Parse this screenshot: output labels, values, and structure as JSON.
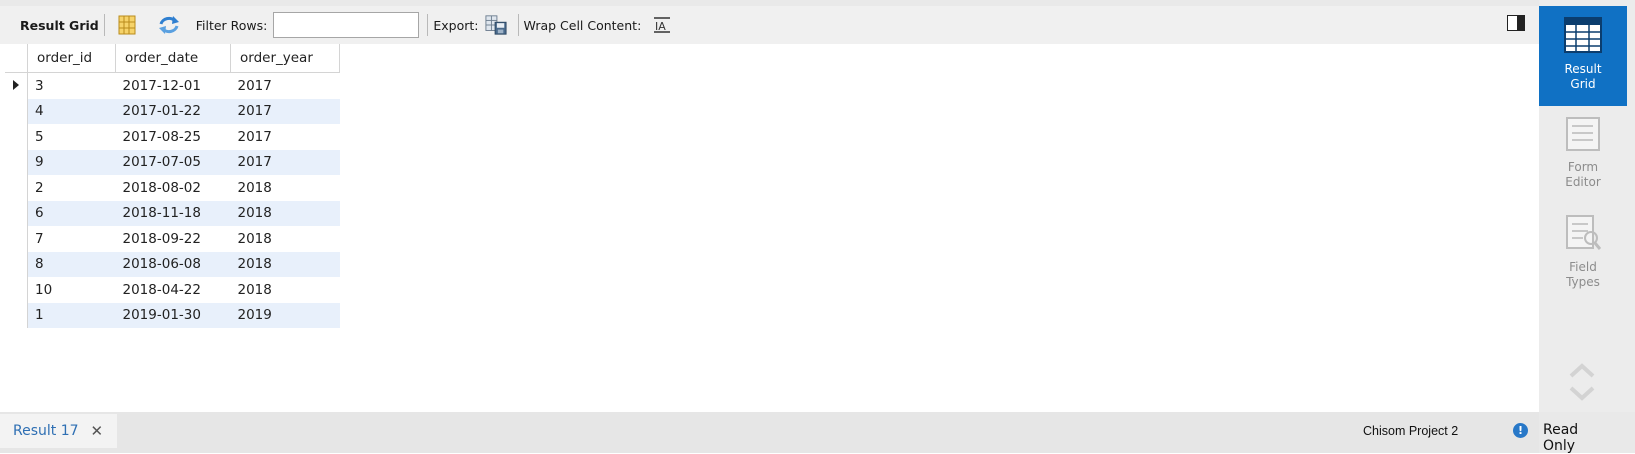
{
  "toolbar": {
    "result_grid_label": "Result Grid",
    "filter_rows_label": "Filter Rows:",
    "filter_rows_value": "",
    "export_label": "Export:",
    "wrap_label": "Wrap Cell Content:"
  },
  "grid": {
    "columns": [
      "order_id",
      "order_date",
      "order_year"
    ],
    "rows": [
      [
        "3",
        "2017-12-01",
        "2017"
      ],
      [
        "4",
        "2017-01-22",
        "2017"
      ],
      [
        "5",
        "2017-08-25",
        "2017"
      ],
      [
        "9",
        "2017-07-05",
        "2017"
      ],
      [
        "2",
        "2018-08-02",
        "2018"
      ],
      [
        "6",
        "2018-11-18",
        "2018"
      ],
      [
        "7",
        "2018-09-22",
        "2018"
      ],
      [
        "8",
        "2018-06-08",
        "2018"
      ],
      [
        "10",
        "2018-04-22",
        "2018"
      ],
      [
        "1",
        "2019-01-30",
        "2019"
      ]
    ]
  },
  "bottom": {
    "tab_label": "Result 17",
    "project": "Chisom Project 2",
    "status": "Read Only"
  },
  "sidebar": {
    "result_grid": "Result Grid",
    "form_editor": "Form Editor",
    "field_types": "Field Types"
  },
  "colors": {
    "accent": "#1071c4",
    "row_alt": "#e8f0fb"
  }
}
